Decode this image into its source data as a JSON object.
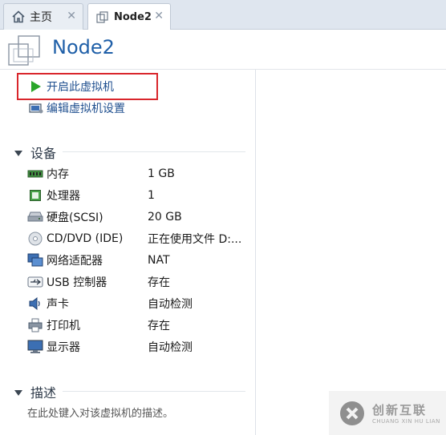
{
  "tabs": [
    {
      "label": "主页",
      "icon": "home-icon",
      "active": false
    },
    {
      "label": "Node2",
      "icon": "vm-icon",
      "active": true
    }
  ],
  "header": {
    "title": "Node2"
  },
  "actions": {
    "power_on": "开启此虚拟机",
    "edit_settings": "编辑虚拟机设置"
  },
  "devices": {
    "section_title": "设备",
    "items": [
      {
        "name": "内存",
        "value": "1 GB",
        "icon": "memory-icon"
      },
      {
        "name": "处理器",
        "value": "1",
        "icon": "processor-icon"
      },
      {
        "name": "硬盘(SCSI)",
        "value": "20 GB",
        "icon": "hard-disk-icon"
      },
      {
        "name": "CD/DVD (IDE)",
        "value": "正在使用文件 D:...",
        "icon": "cd-dvd-icon"
      },
      {
        "name": "网络适配器",
        "value": "NAT",
        "icon": "network-adapter-icon"
      },
      {
        "name": "USB 控制器",
        "value": "存在",
        "icon": "usb-icon"
      },
      {
        "name": "声卡",
        "value": "自动检测",
        "icon": "sound-card-icon"
      },
      {
        "name": "打印机",
        "value": "存在",
        "icon": "printer-icon"
      },
      {
        "name": "显示器",
        "value": "自动检测",
        "icon": "display-icon"
      }
    ]
  },
  "description": {
    "section_title": "描述",
    "placeholder": "在此处键入对该虚拟机的描述。"
  },
  "watermark": {
    "name": "创新互联",
    "sub": "CHUANG XIN HU LIAN"
  },
  "colors": {
    "title": "#1f5fa8",
    "link": "#1f4f8f",
    "highlight": "#d9262c",
    "play": "#2aa52a"
  }
}
